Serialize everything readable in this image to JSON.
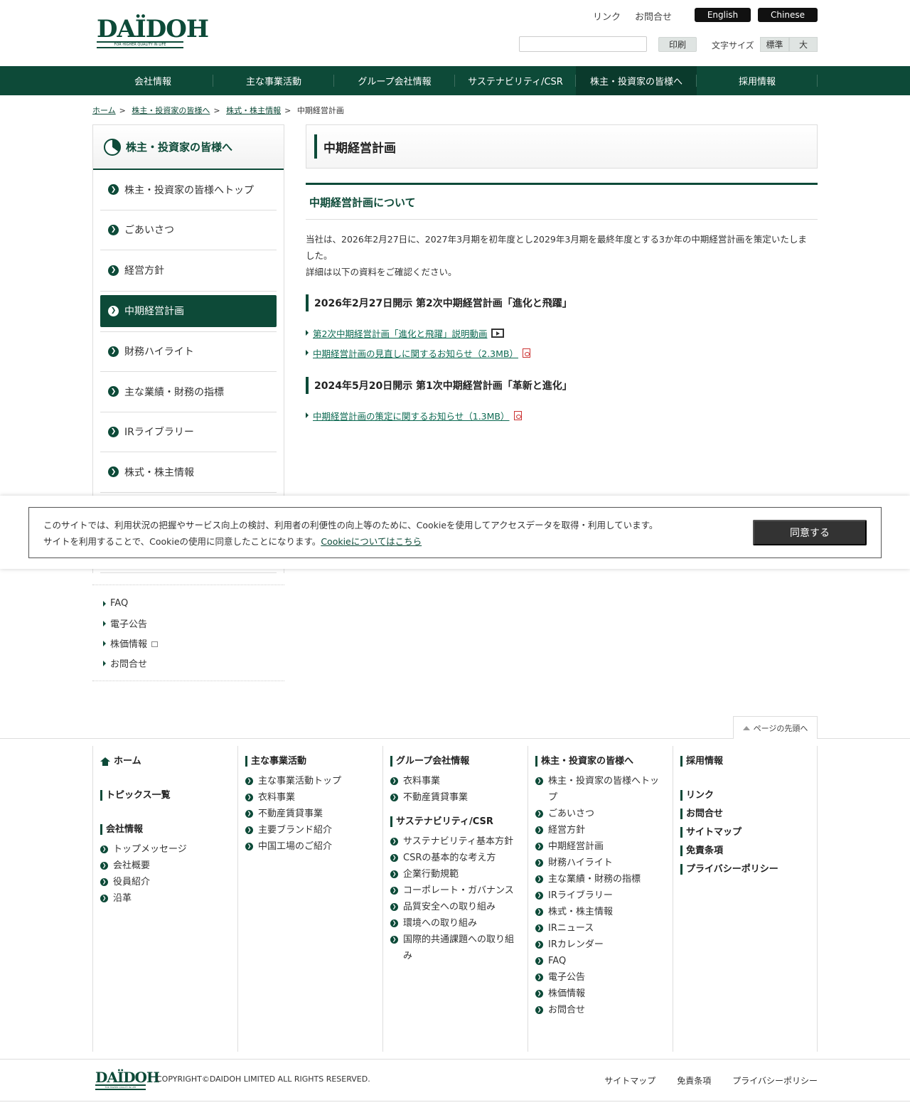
{
  "header": {
    "logo_text": "DAÏDOH",
    "logo_tagline": "FOR HIGHER QUALITY IN LIFE",
    "util_links": [
      "リンク",
      "お問合せ"
    ],
    "lang_english": "English",
    "lang_chinese": "Chinese",
    "search_placeholder": "",
    "print_label": "印刷",
    "font_size_label": "文字サイズ",
    "font_size_standard": "標準",
    "font_size_large": "大"
  },
  "gnav": [
    "会社情報",
    "主な事業活動",
    "グループ会社情報",
    "サステナビリティ/CSR",
    "株主・投資家の皆様へ",
    "採用情報"
  ],
  "breadcrumb": [
    "ホーム",
    "株主・投資家の皆様へ",
    "株式・株主情報",
    "中期経営計画"
  ],
  "sidebar": {
    "title": "株主・投資家の皆様へ",
    "items": [
      "株主・投資家の皆様へトップ",
      "ごあいさつ",
      "経営方針",
      "中期経営計画",
      "財務ハイライト",
      "主な業績・財務の指標",
      "IRライブラリー",
      "株式・株主情報"
    ],
    "links": [
      "FAQ",
      "電子公告",
      "株価情報",
      "お問合せ"
    ]
  },
  "content": {
    "page_title": "中期経営計画",
    "section_title": "中期経営計画について",
    "intro_line1": "当社は、2026年2月27日に、2027年3月期を初年度とし2029年3月期を最終年度とする3か年の中期経営計画を策定いたしま",
    "intro_line2": "した。",
    "intro_line3": "詳細は以下の資料をご確認ください。",
    "plan2_title": "2026年2月27日開示 第2次中期経営計画「進化と飛躍」",
    "plan2_docs": [
      "第2次中期経営計画「進化と飛躍」説明動画",
      "中期経営計画の見直しに関するお知らせ（2.3MB）"
    ],
    "plan1_title": "2024年5月20日開示 第1次中期経営計画「革新と進化」",
    "plan1_docs": [
      "中期経営計画の策定に関するお知らせ（1.3MB）"
    ]
  },
  "cookie": {
    "line1": "このサイトでは、利用状況の把握やサービス向上の検討、利用者の利便性の向上等のために、Cookieを使用してアクセスデータを取得・利用しています。",
    "line2": "サイトを利用することで、Cookieの使用に同意したことになります。",
    "link": "Cookieについてはこちら",
    "agree": "同意する"
  },
  "pagetop": "ページの先頭へ",
  "footer": {
    "col1": {
      "home": "ホーム",
      "topics": "トピックス一覧",
      "company": "会社情報",
      "company_items": [
        "トップメッセージ",
        "会社概要",
        "役員紹介",
        "沿革"
      ]
    },
    "col2": {
      "business": "主な事業活動",
      "business_items": [
        "主な事業活動トップ",
        "衣料事業",
        "不動産賃貸事業",
        "主要ブランド紹介",
        "中国工場のご紹介"
      ]
    },
    "col3": {
      "group": "グループ会社情報",
      "group_items": [
        "衣料事業",
        "不動産賃貸事業"
      ],
      "csr": "サステナビリティ/CSR",
      "csr_items": [
        "サステナビリティ基本方針",
        "CSRの基本的な考え方",
        "企業行動規範",
        "コーポレート・ガバナンス",
        "品質安全への取り組み",
        "環境への取り組み",
        "国際的共通課題への取り組み"
      ]
    },
    "col4": {
      "ir": "株主・投資家の皆様へ",
      "ir_items": [
        "株主・投資家の皆様へトップ",
        "ごあいさつ",
        "経営方針",
        "中期経営計画",
        "財務ハイライト",
        "主な業績・財務の指標",
        "IRライブラリー",
        "株式・株主情報",
        "IRニュース",
        "IRカレンダー",
        "FAQ",
        "電子公告",
        "株価情報",
        "お問合せ"
      ]
    },
    "col5": {
      "recruit": "採用情報",
      "links": [
        "リンク",
        "お問合せ",
        "サイトマップ",
        "免責条項",
        "プライバシーポリシー"
      ]
    },
    "copyright": "COPYRIGHT©DAIDOH LIMITED ALL RIGHTS RESERVED.",
    "bottom_links": [
      "サイトマップ",
      "免責条項",
      "プライバシーポリシー"
    ]
  }
}
